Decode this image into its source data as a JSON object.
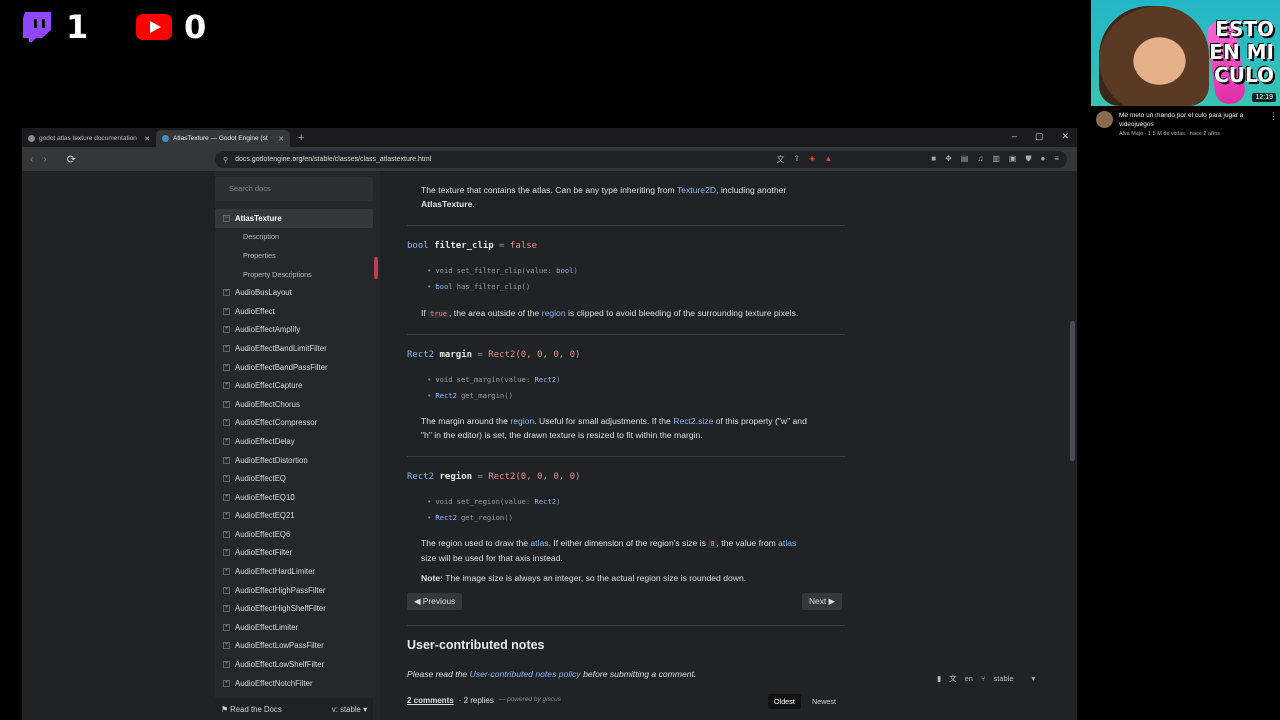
{
  "stream": {
    "twitch_count": "1",
    "youtube_count": "0",
    "twitch_color": "#9146ff",
    "youtube_color": "#ff0000"
  },
  "video_overlay": {
    "thumb_text": "ESTO EN MI CULO",
    "duration": "12:19",
    "title": "Me meto un mando por el culo para jugar a videojuegos",
    "meta": "Alva Majo · 1.5 M de vistas · hace 2 años",
    "menu_icon": "more-vert-icon"
  },
  "browser": {
    "tabs": [
      {
        "title": "godot atlas texture documentation",
        "active": false
      },
      {
        "title": "AtlasTexture — Godot Engine (st",
        "active": true
      }
    ],
    "new_tab_label": "+",
    "window_controls": [
      "–",
      "▢",
      "✕"
    ],
    "url": "docs.godotengine.org/en/stable/classes/class_atlastexture.html"
  },
  "sidebar": {
    "search_placeholder": "Search docs",
    "items": [
      {
        "label": "AtlasTexture",
        "type": "current"
      },
      {
        "label": "Description",
        "type": "sub"
      },
      {
        "label": "Properties",
        "type": "sub"
      },
      {
        "label": "Property Descriptions",
        "type": "sub"
      },
      {
        "label": "AudioBusLayout",
        "type": "item"
      },
      {
        "label": "AudioEffect",
        "type": "item"
      },
      {
        "label": "AudioEffectAmplify",
        "type": "item"
      },
      {
        "label": "AudioEffectBandLimitFilter",
        "type": "item"
      },
      {
        "label": "AudioEffectBandPassFilter",
        "type": "item"
      },
      {
        "label": "AudioEffectCapture",
        "type": "item"
      },
      {
        "label": "AudioEffectChorus",
        "type": "item"
      },
      {
        "label": "AudioEffectCompressor",
        "type": "item"
      },
      {
        "label": "AudioEffectDelay",
        "type": "item"
      },
      {
        "label": "AudioEffectDistortion",
        "type": "item"
      },
      {
        "label": "AudioEffectEQ",
        "type": "item"
      },
      {
        "label": "AudioEffectEQ10",
        "type": "item"
      },
      {
        "label": "AudioEffectEQ21",
        "type": "item"
      },
      {
        "label": "AudioEffectEQ6",
        "type": "item"
      },
      {
        "label": "AudioEffectFilter",
        "type": "item"
      },
      {
        "label": "AudioEffectHardLimiter",
        "type": "item"
      },
      {
        "label": "AudioEffectHighPassFilter",
        "type": "item"
      },
      {
        "label": "AudioEffectHighShelfFilter",
        "type": "item"
      },
      {
        "label": "AudioEffectLimiter",
        "type": "item"
      },
      {
        "label": "AudioEffectLowPassFilter",
        "type": "item"
      },
      {
        "label": "AudioEffectLowShelfFilter",
        "type": "item"
      },
      {
        "label": "AudioEffectNotchFilter",
        "type": "item"
      }
    ],
    "rtd_label": "Read the Docs",
    "version_label": "v: stable"
  },
  "content": {
    "atlas_desc_1": "The texture that contains the atlas. Can be any type inheriting from ",
    "atlas_desc_link": "Texture2D",
    "atlas_desc_2": ", including another",
    "atlas_desc_3": "AtlasTexture",
    "atlas_desc_4": ".",
    "filter_clip": {
      "type": "bool",
      "name": "filter_clip",
      "default": "false",
      "setter_ret": "void",
      "setter": "set_filter_clip(value: ",
      "setter_arg": "bool",
      "getter_ret": "bool",
      "getter": "has_filter_clip()",
      "desc_pre": "If ",
      "desc_code": "true",
      "desc_mid": ", the area outside of the ",
      "desc_link": "region",
      "desc_post": " is clipped to avoid bleeding of the surrounding texture pixels."
    },
    "margin": {
      "type": "Rect2",
      "name": "margin",
      "default": "Rect2(0, 0, 0, 0)",
      "setter_ret": "void",
      "setter": "set_margin(value: ",
      "setter_arg": "Rect2",
      "getter_ret": "Rect2",
      "getter": "get_margin()",
      "desc_1": "The margin around the ",
      "desc_link1": "region",
      "desc_2": ". Useful for small adjustments. If the ",
      "desc_link2": "Rect2.size",
      "desc_3": " of this property (\"w\" and",
      "desc_4": "\"h\" in the editor) is set, the drawn texture is resized to fit within the margin."
    },
    "region": {
      "type": "Rect2",
      "name": "region",
      "default": "Rect2(0, 0, 0, 0)",
      "setter_ret": "void",
      "setter": "set_region(value: ",
      "setter_arg": "Rect2",
      "getter_ret": "Rect2",
      "getter": "get_region()",
      "desc_1": "The region used to draw the ",
      "desc_link1": "atlas",
      "desc_2": ". If either dimension of the region's size is ",
      "desc_code": "0",
      "desc_3": ", the value from ",
      "desc_link2": "atlas",
      "desc_4": "size will be used for that axis instead.",
      "note_label": "Note:",
      "note": " The image size is always an integer, so the actual region size is rounded down."
    },
    "prev_label": "Previous",
    "next_label": "Next",
    "notes_heading": "User-contributed notes",
    "notes_please": "Please read the ",
    "notes_link": "User-contributed notes policy",
    "notes_after": " before submitting a comment.",
    "comments_count": "2 comments",
    "replies_count": "· 2 replies",
    "powered": "— powered by giscus",
    "sort_oldest": "Oldest",
    "sort_newest": "Newest",
    "lang": "en",
    "version": "stable"
  }
}
